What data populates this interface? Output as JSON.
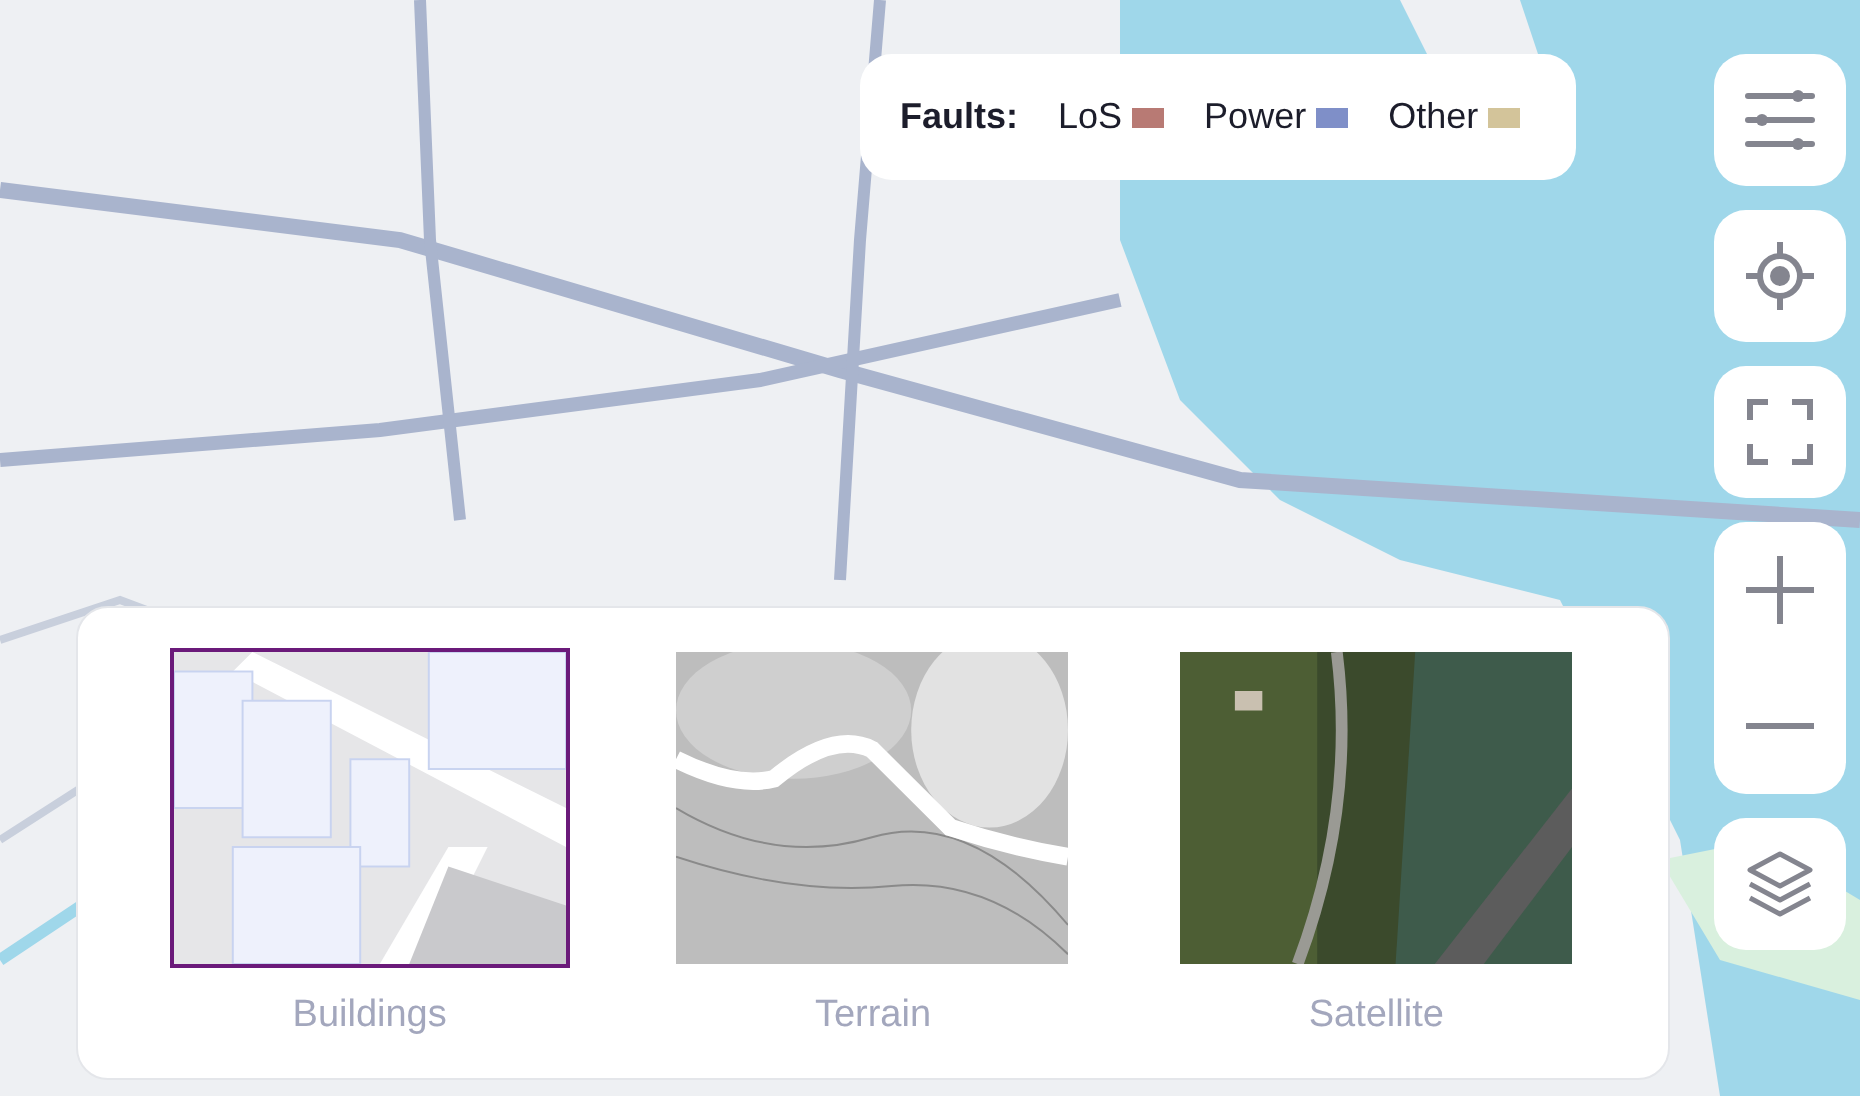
{
  "legend": {
    "title": "Faults:",
    "items": [
      {
        "label": "LoS",
        "color": "#b87a74"
      },
      {
        "label": "Power",
        "color": "#7f8fc8"
      },
      {
        "label": "Other",
        "color": "#d3c49a"
      }
    ]
  },
  "map_controls": [
    {
      "kind": "filters"
    },
    {
      "kind": "locate"
    },
    {
      "kind": "fullscreen"
    },
    {
      "kind": "zoom"
    },
    {
      "kind": "layers"
    }
  ],
  "layers": [
    {
      "label": "Buildings",
      "kind": "buildings",
      "selected": true
    },
    {
      "label": "Terrain",
      "kind": "terrain",
      "selected": false
    },
    {
      "label": "Satellite",
      "kind": "satellite",
      "selected": false
    }
  ]
}
